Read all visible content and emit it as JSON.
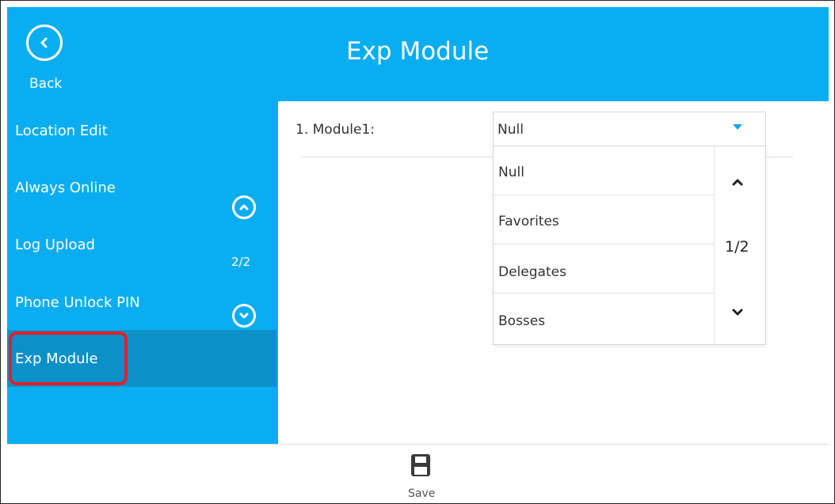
{
  "header": {
    "title": "Exp Module",
    "back_label": "Back"
  },
  "sidebar": {
    "items": [
      {
        "label": "Location Edit"
      },
      {
        "label": "Always Online"
      },
      {
        "label": "Log Upload"
      },
      {
        "label": "Phone Unlock PIN"
      },
      {
        "label": "Exp Module",
        "selected": true
      }
    ],
    "page_indicator": "2/2"
  },
  "main": {
    "field_label": "1. Module1:",
    "select_value": "Null",
    "dropdown": {
      "options": [
        "Null",
        "Favorites",
        "Delegates",
        "Bosses"
      ],
      "page_indicator": "1/2"
    }
  },
  "footer": {
    "save_label": "Save"
  },
  "colors": {
    "accent": "#0aaef0",
    "sidebar_selected": "#0b90c8",
    "highlight": "#e0202a",
    "dropdown_arrow": "#1aa3e8"
  },
  "icons": [
    "chevron-left-icon",
    "chevron-up-icon",
    "chevron-down-icon",
    "caret-down-icon",
    "save-icon"
  ]
}
